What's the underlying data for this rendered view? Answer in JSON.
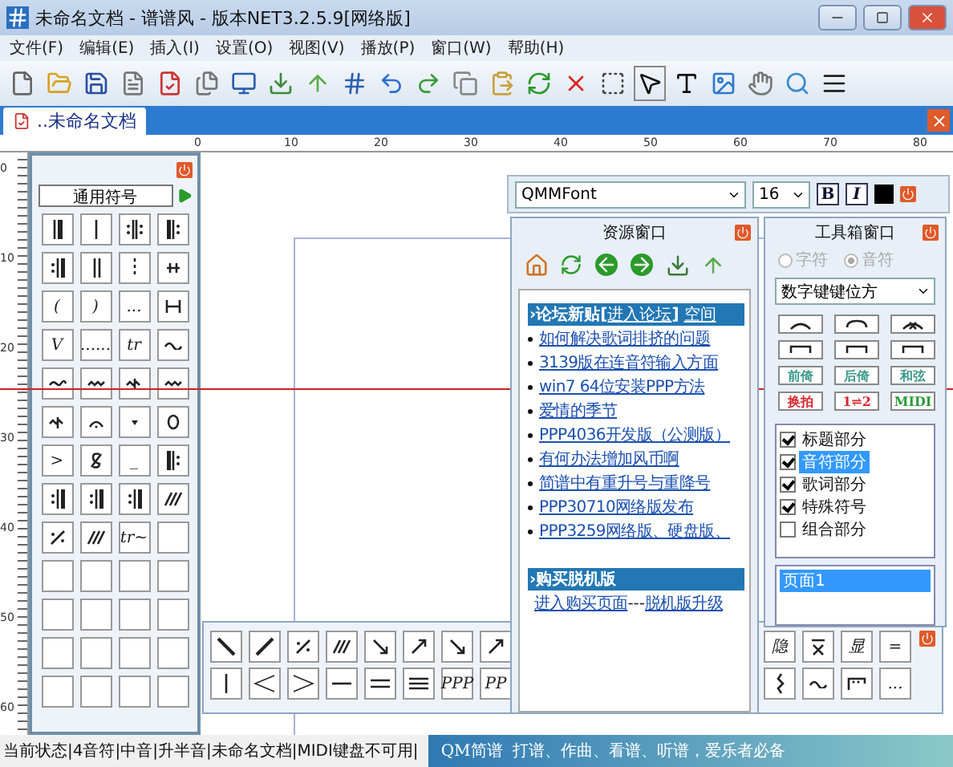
{
  "window": {
    "title": "未命名文档 - 谱谱风 - 版本NET3.2.5.9[网络版]"
  },
  "menu": [
    "文件(F)",
    "编辑(E)",
    "插入(I)",
    "设置(O)",
    "视图(V)",
    "播放(P)",
    "窗口(W)",
    "帮助(H)"
  ],
  "document_tab": {
    "label": "..未命名文档",
    "selected": true
  },
  "ruler": {
    "horizontal": [
      "0",
      "10",
      "20",
      "30",
      "40",
      "50",
      "60",
      "70",
      "80"
    ],
    "vertical": [
      "0",
      "10",
      "20",
      "30",
      "40",
      "50",
      "60"
    ]
  },
  "symbol_panel": {
    "title": "通用符号",
    "symbols": [
      {
        "kind": "barthick"
      },
      {
        "kind": "bar1"
      },
      {
        "kind": "repeatboth"
      },
      {
        "kind": "repeatstart"
      },
      {
        "kind": "repeatend"
      },
      {
        "kind": "bar2"
      },
      {
        "kind": "dashed"
      },
      {
        "kind": "mark"
      },
      {
        "kind": "text",
        "label": "("
      },
      {
        "kind": "text",
        "label": ")"
      },
      {
        "kind": "text",
        "label": "..."
      },
      {
        "kind": "hbracket"
      },
      {
        "kind": "text",
        "label": "V"
      },
      {
        "kind": "text",
        "label": "......"
      },
      {
        "kind": "text",
        "label": "tr"
      },
      {
        "kind": "wave"
      },
      {
        "kind": "turn"
      },
      {
        "kind": "mordent"
      },
      {
        "kind": "mordentline"
      },
      {
        "kind": "mordent"
      },
      {
        "kind": "mordentline"
      },
      {
        "kind": "arc"
      },
      {
        "kind": "dot"
      },
      {
        "kind": "theta"
      },
      {
        "kind": "text",
        "label": ">"
      },
      {
        "kind": "segno"
      },
      {
        "kind": "text",
        "label": "_"
      },
      {
        "kind": "repeatstart"
      },
      {
        "kind": "repeatend"
      },
      {
        "kind": "repeatend"
      },
      {
        "kind": "repeatend"
      },
      {
        "kind": "slashes"
      },
      {
        "kind": "percent"
      },
      {
        "kind": "slashes"
      },
      {
        "kind": "text",
        "label": "tr~"
      },
      {
        "kind": "empty"
      },
      {
        "kind": "empty"
      },
      {
        "kind": "empty"
      },
      {
        "kind": "empty"
      },
      {
        "kind": "empty"
      },
      {
        "kind": "empty"
      },
      {
        "kind": "empty"
      },
      {
        "kind": "empty"
      },
      {
        "kind": "empty"
      },
      {
        "kind": "empty"
      },
      {
        "kind": "empty"
      },
      {
        "kind": "empty"
      },
      {
        "kind": "empty"
      },
      {
        "kind": "empty"
      },
      {
        "kind": "empty"
      },
      {
        "kind": "empty"
      },
      {
        "kind": "empty"
      }
    ]
  },
  "font_bar": {
    "font": "QMMFont",
    "size": "16",
    "bold": "B",
    "italic": "I"
  },
  "resource_window": {
    "title": "资源窗口",
    "forum_header": {
      "prefix": "›论坛新贴[",
      "link": "进入论坛",
      "suffix": "]",
      "link_2": "空间"
    },
    "posts": [
      "如何解决歌词排挤的问题",
      "3139版在连音符输入方面",
      "win7 64位安装PPP方法",
      "爱情的季节",
      "PPP4036开发版（公测版）",
      "有何办法增加风币啊",
      "简谱中有重升号与重降号",
      "PPP30710网络版发布",
      "PPP3259网络版、硬盘版、"
    ],
    "buy_header": "›购买脱机版",
    "buy_links": {
      "link": "进入购买页面",
      "separator": "---",
      "link_2": "脱机版升级"
    }
  },
  "toolbox": {
    "title": "工具箱窗口",
    "radios": [
      {
        "label": "字符",
        "selected": false,
        "disabled": true
      },
      {
        "label": "音符",
        "selected": true,
        "disabled": true
      }
    ],
    "layout_select": "数字键键位方",
    "buttons": [
      {
        "kind": "slur"
      },
      {
        "kind": "tie"
      },
      {
        "kind": "xslur"
      },
      {
        "kind": "bracket"
      },
      {
        "kind": "bracket"
      },
      {
        "kind": "bracket"
      },
      {
        "kind": "text",
        "label": "前倚",
        "color": "#3a9a8a"
      },
      {
        "kind": "text",
        "label": "后倚",
        "color": "#3a9a8a"
      },
      {
        "kind": "text",
        "label": "和弦",
        "color": "#3a9a8a"
      },
      {
        "kind": "text",
        "label": "换拍",
        "color": "#d8262e"
      },
      {
        "kind": "text",
        "label": "1⇌2",
        "color": "#d8262e"
      },
      {
        "kind": "text",
        "label": "MIDI",
        "color": "#2a9a3a"
      }
    ],
    "parts": [
      {
        "label": "标题部分",
        "checked": true,
        "selected": false
      },
      {
        "label": "音符部分",
        "checked": true,
        "selected": true
      },
      {
        "label": "歌词部分",
        "checked": true,
        "selected": false
      },
      {
        "label": "特殊符号",
        "checked": true,
        "selected": false
      },
      {
        "label": "组合部分",
        "checked": false,
        "selected": false
      }
    ],
    "pages": [
      {
        "label": "页面1",
        "selected": true
      }
    ]
  },
  "bottom_bar": {
    "left": [
      {
        "kind": "diagdown"
      },
      {
        "kind": "diagup"
      },
      {
        "kind": "percent"
      },
      {
        "kind": "slashes"
      },
      {
        "kind": "arrowdown"
      },
      {
        "kind": "arrowup"
      },
      {
        "kind": "arrowdown"
      },
      {
        "kind": "arrowup"
      },
      {
        "kind": "bar1"
      },
      {
        "kind": "cresc"
      },
      {
        "kind": "decresc"
      },
      {
        "kind": "line1"
      },
      {
        "kind": "line2"
      },
      {
        "kind": "line3"
      },
      {
        "kind": "text",
        "label": "PPP"
      },
      {
        "kind": "text",
        "label": "PP"
      }
    ],
    "right": [
      {
        "kind": "text",
        "label": "隐"
      },
      {
        "kind": "xbar"
      },
      {
        "kind": "text",
        "label": "显"
      },
      {
        "kind": "text",
        "label": "="
      },
      {
        "kind": "squiggle"
      },
      {
        "kind": "wave"
      },
      {
        "kind": "bracketdots"
      },
      {
        "kind": "text",
        "label": "..."
      }
    ]
  },
  "status_bar": {
    "text": "当前状态|4音符|中音|升半音|未命名文档|MIDI键盘不可用|",
    "banner": "QM简谱  打谱、作曲、看谱、听谱，爱乐者必备"
  }
}
